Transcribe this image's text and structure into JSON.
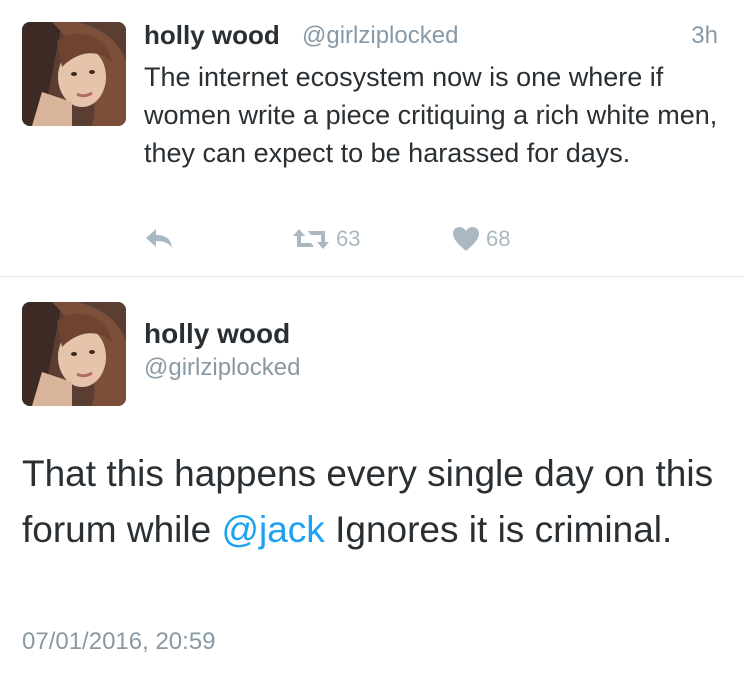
{
  "tweet1": {
    "name": "holly wood",
    "handle": "@girlziplocked",
    "time": "3h",
    "text": "The internet ecosystem now is one where if women write a piece critiquing a rich white men, they can expect to be harassed for days.",
    "actions": {
      "reply_icon": "reply-icon",
      "retweet_icon": "retweet-icon",
      "retweet_count": "63",
      "like_icon": "heart-icon",
      "like_count": "68"
    }
  },
  "tweet2": {
    "name": "holly wood",
    "handle": "@girlziplocked",
    "text_before": "That this happens every single day on this forum while ",
    "mention": "@jack",
    "text_after": " Ignores it is criminal.",
    "timestamp": "07/01/2016, 20:59"
  },
  "colors": {
    "text": "#292f33",
    "secondary": "#8899a6",
    "action": "#aab8c2",
    "link": "#1da1f2",
    "divider": "#e1e8ed"
  }
}
